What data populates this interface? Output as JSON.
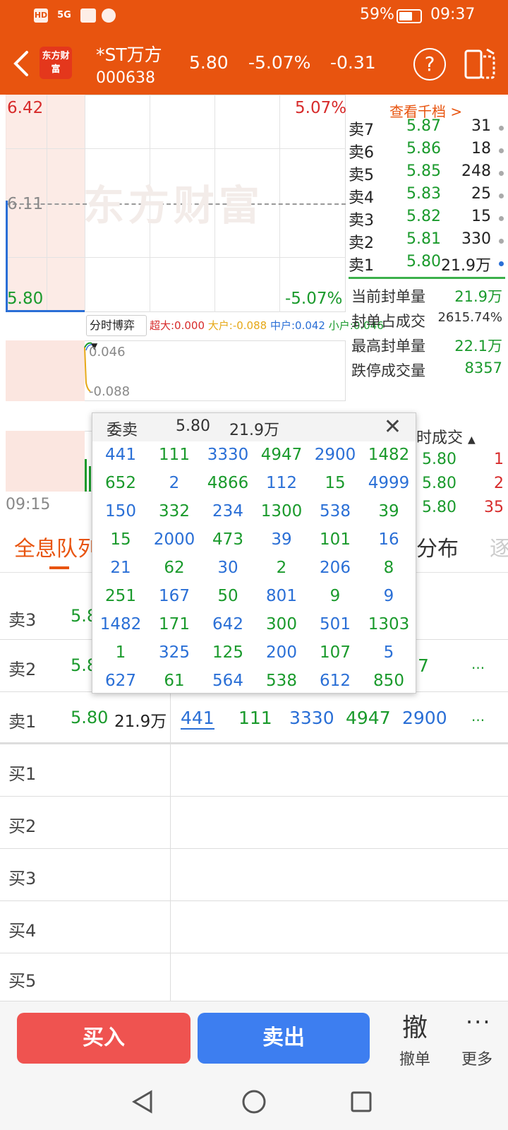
{
  "status_bar": {
    "left_icons": [
      "HD",
      "5G"
    ],
    "battery": "59%",
    "time": "09:37"
  },
  "header": {
    "logo_text": "东方财富",
    "stock_name": "*ST万方",
    "stock_code": "000638",
    "price": "5.80",
    "change_pct": "-5.07%",
    "change": "-0.31",
    "help_label": "?"
  },
  "chart": {
    "price_high": "6.42",
    "price_mid": "6.11",
    "price_low": "5.80",
    "pct_high": "5.07%",
    "pct_low": "-5.07%",
    "watermark": "东方财富",
    "time_start": "09:15",
    "bobo_dropdown": "分时博弈",
    "bobo_items": [
      {
        "label": "超大:0.000",
        "color": "#d72b2b"
      },
      {
        "label": "大户:-0.088",
        "color": "#e6a817"
      },
      {
        "label": "中户:0.042",
        "color": "#2a6fd6"
      },
      {
        "label": "小户:0.046",
        "color": "#1a9a2c"
      }
    ],
    "sub_val_top": "0.046",
    "sub_val_bottom": "-0.088"
  },
  "order_book": {
    "link": "查看千档 >",
    "asks": [
      {
        "label": "卖7",
        "price": "5.87",
        "vol": "31"
      },
      {
        "label": "卖6",
        "price": "5.86",
        "vol": "18"
      },
      {
        "label": "卖5",
        "price": "5.85",
        "vol": "248"
      },
      {
        "label": "卖4",
        "price": "5.83",
        "vol": "25"
      },
      {
        "label": "卖3",
        "price": "5.82",
        "vol": "15"
      },
      {
        "label": "卖2",
        "price": "5.81",
        "vol": "330"
      },
      {
        "label": "卖1",
        "price": "5.80",
        "vol": "21.9万"
      }
    ],
    "stats": [
      {
        "label": "当前封单量",
        "value": "21.9万"
      },
      {
        "label": "封单占成交",
        "value": "2615.74%"
      },
      {
        "label": "最高封单量",
        "value": "22.1万"
      },
      {
        "label": "跌停成交量",
        "value": "8357"
      }
    ]
  },
  "trades": {
    "header": "时成交",
    "rows": [
      {
        "price": "5.80",
        "vol": "1"
      },
      {
        "price": "5.80",
        "vol": "2"
      },
      {
        "price": "5.80",
        "vol": "35"
      }
    ]
  },
  "tabs": {
    "active": "全息队列",
    "other": "分布",
    "faded": "逐"
  },
  "queue": {
    "rows": [
      {
        "label": "卖3",
        "price": "5.8"
      },
      {
        "label": "卖2",
        "price": "5.8",
        "tail": "7",
        "more": "..."
      },
      {
        "label": "卖1",
        "price": "5.80",
        "vol": "21.9万",
        "items": [
          "441",
          "111",
          "3330",
          "4947",
          "2900"
        ],
        "more": "..."
      },
      {
        "label": "买1"
      },
      {
        "label": "买2"
      },
      {
        "label": "买3"
      },
      {
        "label": "买4"
      },
      {
        "label": "买5"
      }
    ]
  },
  "popup": {
    "title": "委卖",
    "price": "5.80",
    "vol": "21.9万",
    "close": "✕",
    "grid": [
      [
        "441",
        "111",
        "3330",
        "4947",
        "2900",
        "1482"
      ],
      [
        "652",
        "2",
        "4866",
        "112",
        "15",
        "4999"
      ],
      [
        "150",
        "332",
        "234",
        "1300",
        "538",
        "39"
      ],
      [
        "15",
        "2000",
        "473",
        "39",
        "101",
        "16"
      ],
      [
        "21",
        "62",
        "30",
        "2",
        "206",
        "8"
      ],
      [
        "251",
        "167",
        "50",
        "801",
        "9",
        "9"
      ],
      [
        "1482",
        "171",
        "642",
        "300",
        "501",
        "1303"
      ],
      [
        "1",
        "325",
        "125",
        "200",
        "107",
        "5"
      ],
      [
        "627",
        "61",
        "564",
        "538",
        "612",
        "850"
      ]
    ]
  },
  "bottom": {
    "buy": "买入",
    "sell": "卖出",
    "cancel_icon": "撤",
    "cancel": "撤单",
    "more_icon": "···",
    "more": "更多"
  }
}
